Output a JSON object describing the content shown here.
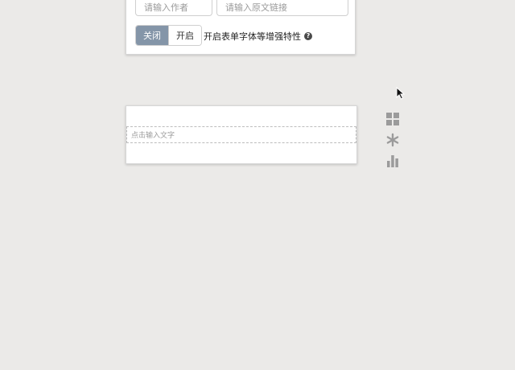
{
  "article_settings": {
    "author_placeholder": "请输入作者",
    "link_placeholder": "请输入原文链接",
    "font_enhance": {
      "off_label": "关闭",
      "on_label": "开启",
      "selected": "关闭",
      "description": "开启表单字体等增强特性",
      "help_icon": "question-circle-icon"
    }
  },
  "text_block": {
    "placeholder": "点击输入文字"
  },
  "toolbar": {
    "icons": [
      "grid-icon",
      "snowflake-icon",
      "bar-chart-icon"
    ]
  },
  "colors": {
    "background": "#ebeae8",
    "toggle_active": "#8495a8",
    "icon": "#9b9b9b"
  }
}
